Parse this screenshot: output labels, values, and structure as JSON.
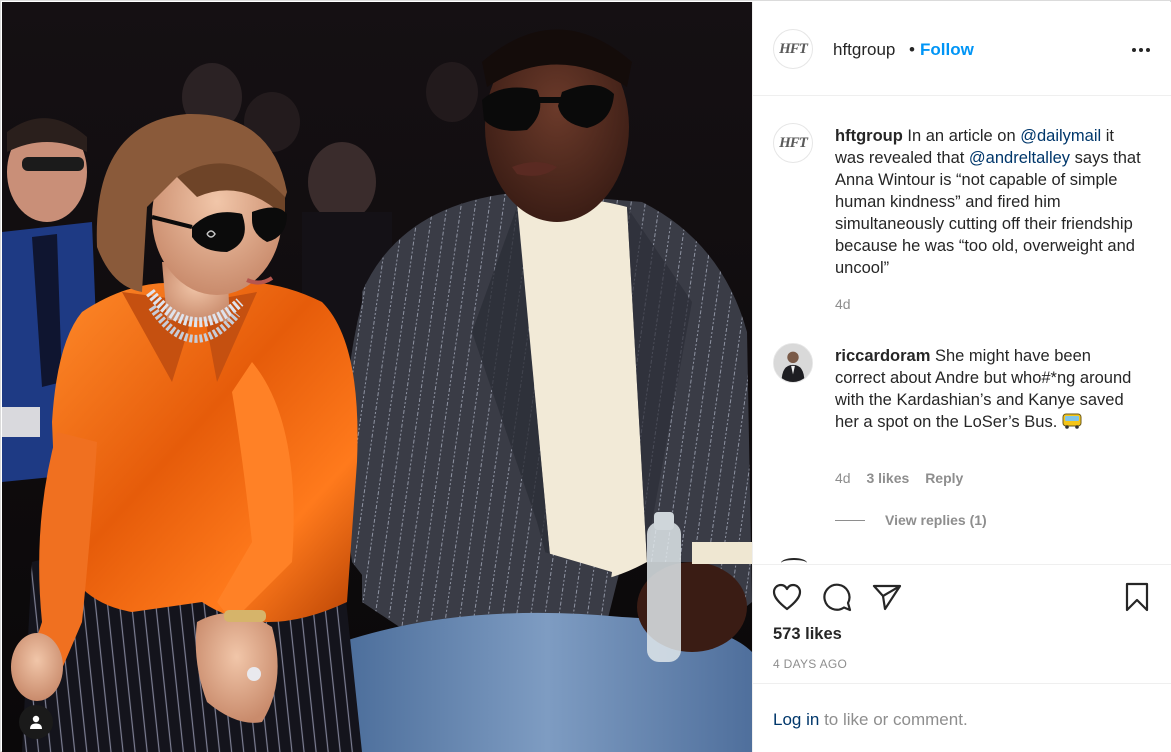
{
  "post": {
    "username": "hftgroup",
    "separator": "•",
    "follow_label": "Follow",
    "avatar_logo_text": "HFT"
  },
  "icons": {
    "more": "more-options-icon",
    "like": "heart-icon",
    "comment": "comment-bubble-icon",
    "share": "paper-plane-icon",
    "save": "bookmark-icon",
    "user_tag": "person-icon",
    "emoji_bus": "bus-emoji-icon"
  },
  "caption": {
    "username": "hftgroup",
    "text_1": "In an article on",
    "mention_1": "@dailymail",
    "text_2": "it was revealed that",
    "mention_2": "@andreltalley",
    "text_3": "says that Anna Wintour is “not capable of simple human kindness” and fired him simultaneously cutting off their friendship because he was “too old, overweight and uncool”",
    "time": "4d"
  },
  "comments": [
    {
      "username": "riccardoram",
      "text": "She might have been correct about Andre but who#*ng around with the Kardashian’s and Kanye saved her a spot on the LoSer’s Bus.",
      "time": "4d",
      "likes": "3 likes",
      "reply_label": "Reply",
      "view_replies": "View replies (1)"
    }
  ],
  "stats": {
    "likes": "573 likes",
    "posted": "4 DAYS AGO"
  },
  "login": {
    "link": "Log in",
    "text": "to like or comment."
  },
  "colors": {
    "accent": "#0095f6",
    "link": "#00376b",
    "muted": "#8e8e8e",
    "text": "#262626",
    "border": "#dbdbdb"
  }
}
